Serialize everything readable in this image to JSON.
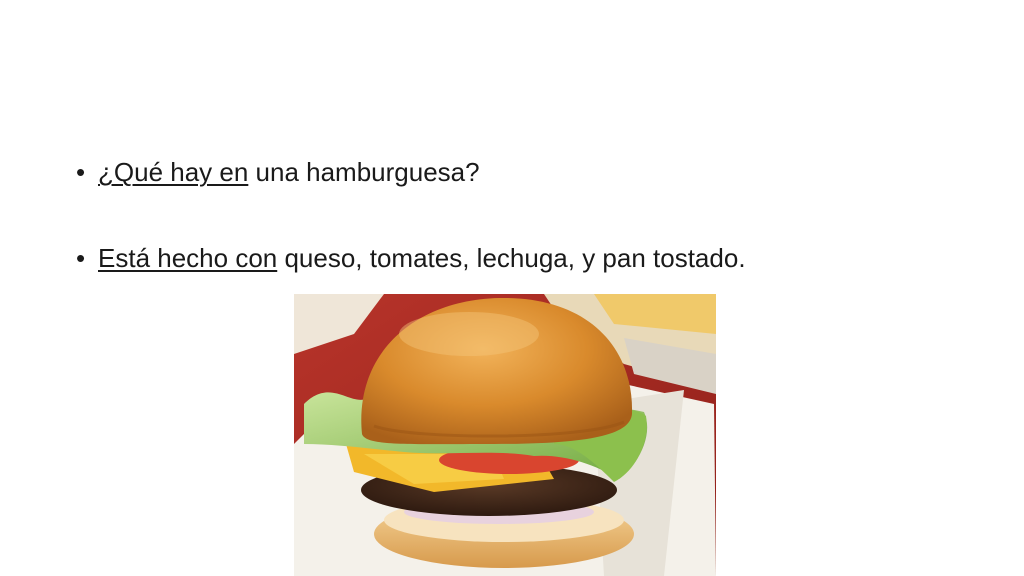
{
  "slide": {
    "bullets": [
      {
        "underlined": "¿Qué hay en",
        "rest": " una hamburguesa?"
      },
      {
        "underlined": "Está hecho con",
        "rest": " queso, tomates, lechuga, y pan tostado."
      }
    ],
    "image": {
      "subject": "hamburger-photo"
    },
    "colors": {
      "background": "#ffffff",
      "text": "#1a1a1a"
    }
  }
}
